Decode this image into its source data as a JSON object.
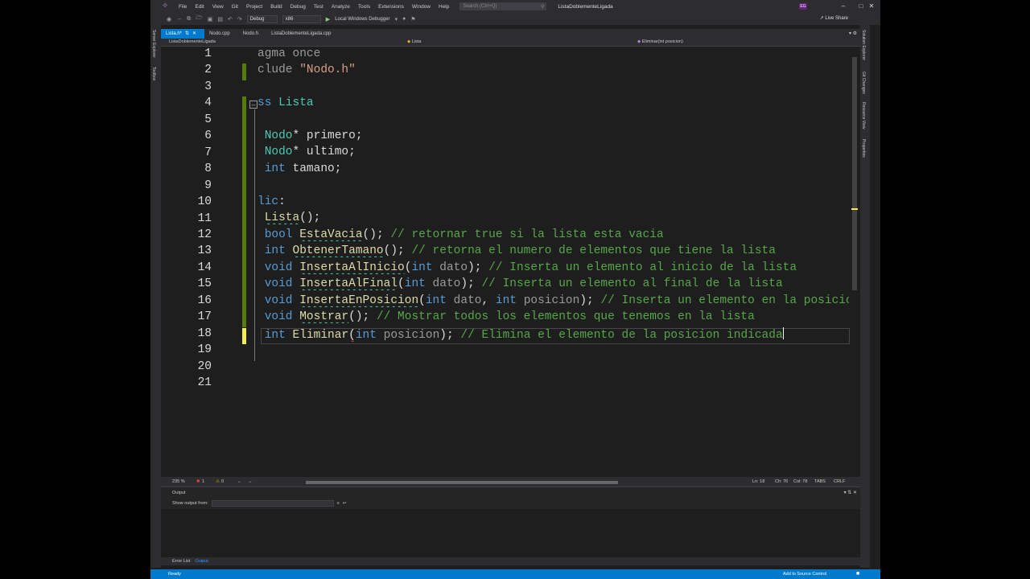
{
  "window": {
    "menus": [
      "File",
      "Edit",
      "View",
      "Git",
      "Project",
      "Build",
      "Debug",
      "Test",
      "Analyze",
      "Tools",
      "Extensions",
      "Window",
      "Help"
    ],
    "search_placeholder": "Search (Ctrl+Q)",
    "title": "ListaDoblementeLigada",
    "account_initials": "EG"
  },
  "toolbar": {
    "configuration": "Debug",
    "platform": "x86",
    "run_target": "Local Windows Debugger",
    "live_share": "Live Share"
  },
  "left_rail": [
    "Server Explorer",
    "Toolbox"
  ],
  "right_rail": [
    "Solution Explorer",
    "Git Changes",
    "Resource View",
    "Properties"
  ],
  "tabs": [
    {
      "label": "Lista.h*",
      "active": true
    },
    {
      "label": "Nodo.cpp",
      "active": false
    },
    {
      "label": "Nodo.h",
      "active": false
    },
    {
      "label": "ListaDoblementeLigada.cpp",
      "active": false
    }
  ],
  "navigation": {
    "project": "ListaDoblementeLigada",
    "scope": "Lista",
    "member": "Eliminar(int posicion)"
  },
  "editor": {
    "line_numbers": [
      "1",
      "2",
      "3",
      "4",
      "5",
      "6",
      "7",
      "8",
      "9",
      "10",
      "11",
      "12",
      "13",
      "14",
      "15",
      "16",
      "17",
      "18",
      "19",
      "20",
      "21"
    ],
    "current_line": 18,
    "lines": {
      "l1_pp": "agma once",
      "l2_pp": "clude ",
      "l2_str": "\"Nodo.h\"",
      "l4_kw": "ss ",
      "l4_type": "Lista",
      "l6_type": "Nodo",
      "l6_rest": "* primero;",
      "l7_type": "Nodo",
      "l7_rest": "* ultimo;",
      "l8_kw": "int",
      "l8_rest": " tamano;",
      "l10_kw": "lic",
      "l10_rest": ":",
      "l11_fn": "Lista",
      "l11_rest": "();",
      "l12_kw": "bool",
      "l12_fn": "EstaVacia",
      "l12_rest": "(); ",
      "l12_cm": "// retornar true si la lista esta vacia",
      "l13_kw": "int",
      "l13_fn": "ObtenerTamano",
      "l13_rest": "(); ",
      "l13_cm": "// retorna el numero de elementos que tiene la lista",
      "l14_kw": "void",
      "l14_fn": "InsertaAlInicio",
      "l14_a": "(",
      "l14_kw2": "int",
      "l14_pa": " dato",
      "l14_b": "); ",
      "l14_cm": "// Inserta un elemento al inicio de la lista",
      "l15_kw": "void",
      "l15_fn": "InsertaAlFinal",
      "l15_a": "(",
      "l15_kw2": "int",
      "l15_pa": " dato",
      "l15_b": "); ",
      "l15_cm": "// Inserta un elemento al final de la lista",
      "l16_kw": "void",
      "l16_fn": "InsertaEnPosicion",
      "l16_a": "(",
      "l16_kw2": "int",
      "l16_pa": " dato",
      "l16_c": ", ",
      "l16_kw3": "int",
      "l16_pa2": " posicion",
      "l16_b": "); ",
      "l16_cm": "// Inserta un elemento en la posicion",
      "l17_kw": "void",
      "l17_fn": "Mostrar",
      "l17_rest": "(); ",
      "l17_cm": "// Mostrar todos los elementos que tenemos en la lista",
      "l18_kw": "int",
      "l18_fn": "Eliminar",
      "l18_a": "(",
      "l18_kw2": "int",
      "l18_pa": " posicion",
      "l18_b": "); ",
      "l18_cm": "// Elimina el elemento de la posicion indicada"
    }
  },
  "editor_status": {
    "zoom": "235 %",
    "errors": "1",
    "warnings": "0",
    "line": "Ln: 18",
    "char": "Ch: 76",
    "col": "Col: 78",
    "tabs": "TABS",
    "eol": "CRLF"
  },
  "output": {
    "title": "Output",
    "show_from_label": "Show output from:"
  },
  "bottom_tabs": [
    {
      "label": "Error List",
      "active": false
    },
    {
      "label": "Output",
      "active": true
    }
  ],
  "statusbar": {
    "ready": "Ready",
    "source_control": "Add to Source Control"
  },
  "colors": {
    "accent": "#007acc",
    "keyword": "#569cd6",
    "type": "#4ec9b0",
    "function": "#dcdcaa",
    "comment": "#57a64a",
    "string": "#d69d85"
  }
}
